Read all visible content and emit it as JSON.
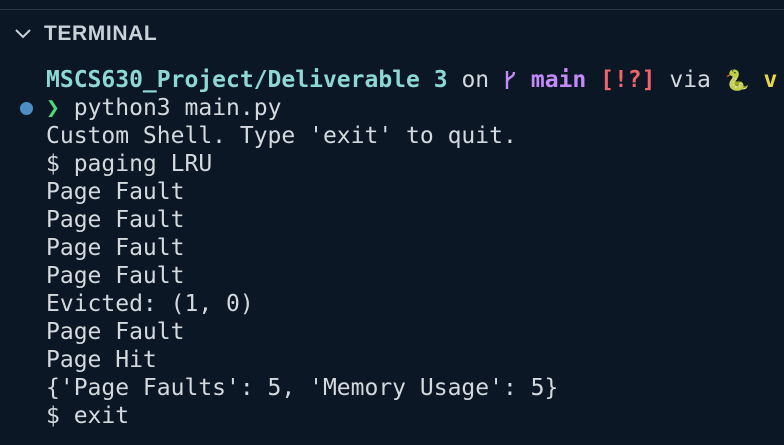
{
  "panel": {
    "title": "TERMINAL",
    "collapse_icon": "chevron-down-icon"
  },
  "prompt": {
    "path": "MSCS630_Project/Deliverable 3",
    "on": "on",
    "branch_icon": "git-branch-icon",
    "branch": "main",
    "status": "[!?]",
    "via": "via",
    "python_icon": "🐍",
    "runtime_initial": "v",
    "arrow": "❯",
    "command": "python3 main.py",
    "decoration_color": "#4d8fc4"
  },
  "output": [
    "Custom Shell. Type 'exit' to quit.",
    "$ paging LRU",
    "Page Fault",
    "Page Fault",
    "Page Fault",
    "Page Fault",
    "Evicted: (1, 0)",
    "Page Fault",
    "Page Hit",
    "{'Page Faults': 5, 'Memory Usage': 5}",
    "$ exit"
  ],
  "colors": {
    "background": "#0b1725",
    "path": "#8ed8d3",
    "branch": "#c58af9",
    "status": "#f0646b",
    "arrow": "#4fd97c",
    "text": "#d4d9de"
  }
}
